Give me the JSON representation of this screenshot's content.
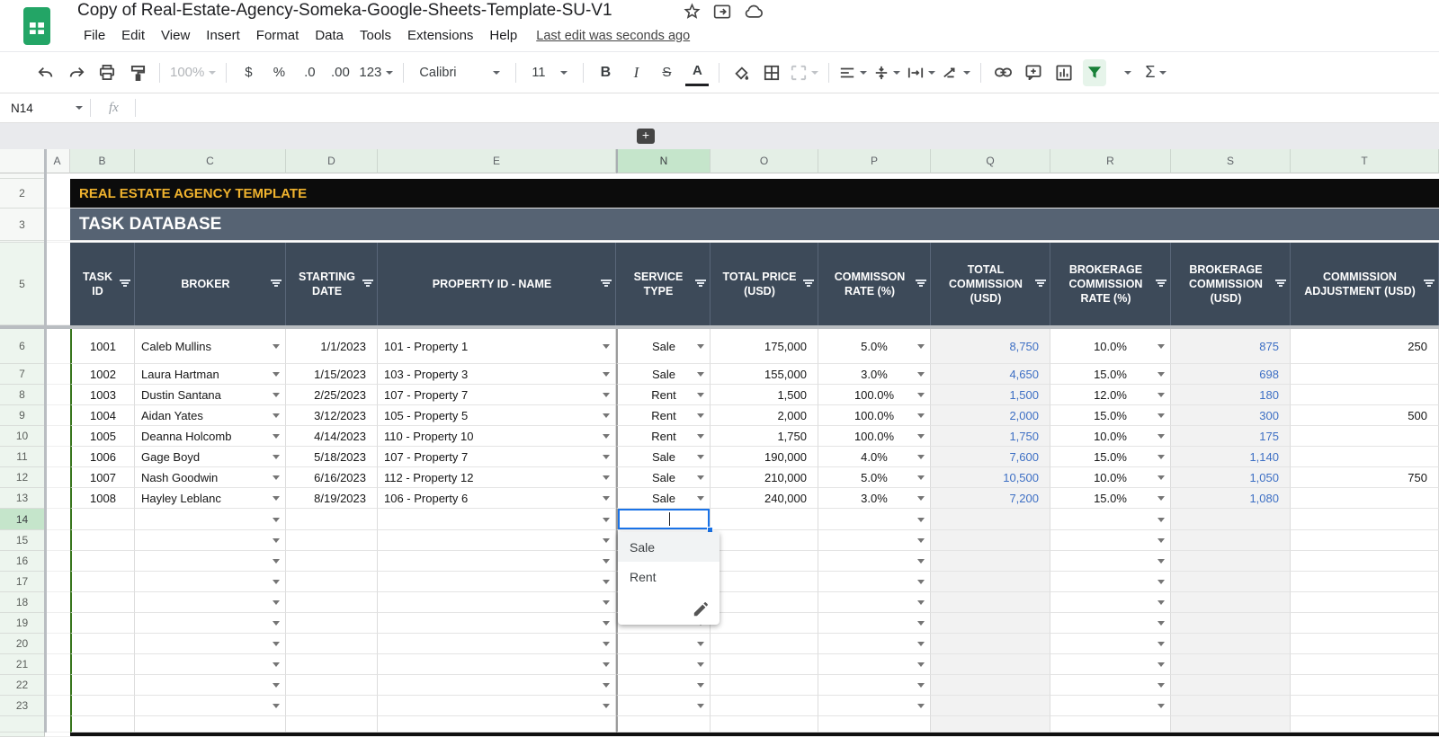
{
  "app": {
    "title": "Copy of Real-Estate-Agency-Someka-Google-Sheets-Template-SU-V1",
    "menu_items": [
      "File",
      "Edit",
      "View",
      "Insert",
      "Format",
      "Data",
      "Tools",
      "Extensions",
      "Help"
    ],
    "last_edit": "Last edit was seconds ago"
  },
  "toolbar": {
    "zoom": "100%",
    "currency": "$",
    "percent": "%",
    "decrease_decimal": ".0",
    "increase_decimal": ".00",
    "more_formats": "123",
    "font": "Calibri",
    "font_size": "11",
    "bold": "B",
    "italic": "I",
    "strikethrough": "S",
    "text_color": "A",
    "functions": "Σ"
  },
  "formula_bar": {
    "name_box": "N14",
    "fx_label": "fx"
  },
  "colors": {
    "accent_blue": "#1a73e8",
    "calc_text_blue": "#3d6fc4",
    "banner_gold": "#f0b32e",
    "header_slate": "#3d4a59",
    "subtitle_slate": "#566373",
    "table_border_green": "#38761d",
    "filter_active_green": "#188038"
  },
  "sheet": {
    "visible_columns": [
      "A",
      "B",
      "C",
      "D",
      "E",
      "N",
      "O",
      "P",
      "Q",
      "R",
      "S",
      "T"
    ],
    "selected_column": "N",
    "selected_row": 14,
    "selected_cell": "N14",
    "expand_columns_button": "+",
    "banner_title": "REAL ESTATE AGENCY TEMPLATE",
    "banner_subtitle": "TASK DATABASE",
    "top_row_numbers": [
      "2",
      "3",
      "5"
    ],
    "headers": [
      "TASK ID",
      "BROKER",
      "STARTING DATE",
      "PROPERTY ID - NAME",
      "SERVICE TYPE",
      "TOTAL PRICE (USD)",
      "COMMISSON RATE (%)",
      "TOTAL COMMISSION (USD)",
      "BROKERAGE COMMISSION RATE (%)",
      "BROKERAGE COMMISSION (USD)",
      "COMMISSION ADJUSTMENT (USD)"
    ],
    "rows": [
      {
        "n": 6,
        "task_id": "1001",
        "broker": "Caleb Mullins",
        "date": "1/1/2023",
        "property": "101 - Property 1",
        "service": "Sale",
        "price": "175,000",
        "rate": "5.0%",
        "commission": "8,750",
        "brokerage_rate": "10.0%",
        "brokerage": "875",
        "adjustment": "250"
      },
      {
        "n": 7,
        "task_id": "1002",
        "broker": "Laura Hartman",
        "date": "1/15/2023",
        "property": "103 - Property 3",
        "service": "Sale",
        "price": "155,000",
        "rate": "3.0%",
        "commission": "4,650",
        "brokerage_rate": "15.0%",
        "brokerage": "698",
        "adjustment": ""
      },
      {
        "n": 8,
        "task_id": "1003",
        "broker": "Dustin Santana",
        "date": "2/25/2023",
        "property": "107 - Property 7",
        "service": "Rent",
        "price": "1,500",
        "rate": "100.0%",
        "commission": "1,500",
        "brokerage_rate": "12.0%",
        "brokerage": "180",
        "adjustment": ""
      },
      {
        "n": 9,
        "task_id": "1004",
        "broker": "Aidan Yates",
        "date": "3/12/2023",
        "property": "105 - Property 5",
        "service": "Rent",
        "price": "2,000",
        "rate": "100.0%",
        "commission": "2,000",
        "brokerage_rate": "15.0%",
        "brokerage": "300",
        "adjustment": "500"
      },
      {
        "n": 10,
        "task_id": "1005",
        "broker": "Deanna Holcomb",
        "date": "4/14/2023",
        "property": "110 - Property 10",
        "service": "Rent",
        "price": "1,750",
        "rate": "100.0%",
        "commission": "1,750",
        "brokerage_rate": "10.0%",
        "brokerage": "175",
        "adjustment": ""
      },
      {
        "n": 11,
        "task_id": "1006",
        "broker": "Gage Boyd",
        "date": "5/18/2023",
        "property": "107 - Property 7",
        "service": "Sale",
        "price": "190,000",
        "rate": "4.0%",
        "commission": "7,600",
        "brokerage_rate": "15.0%",
        "brokerage": "1,140",
        "adjustment": ""
      },
      {
        "n": 12,
        "task_id": "1007",
        "broker": "Nash Goodwin",
        "date": "6/16/2023",
        "property": "112 - Property 12",
        "service": "Sale",
        "price": "210,000",
        "rate": "5.0%",
        "commission": "10,500",
        "brokerage_rate": "10.0%",
        "brokerage": "1,050",
        "adjustment": "750"
      },
      {
        "n": 13,
        "task_id": "1008",
        "broker": "Hayley Leblanc",
        "date": "8/19/2023",
        "property": "106 - Property 6",
        "service": "Sale",
        "price": "240,000",
        "rate": "3.0%",
        "commission": "7,200",
        "brokerage_rate": "15.0%",
        "brokerage": "1,080",
        "adjustment": ""
      }
    ],
    "empty_row_numbers": [
      15,
      16,
      17,
      18,
      19,
      20,
      21,
      22,
      23
    ],
    "dropdown": {
      "options": [
        "Sale",
        "Rent"
      ],
      "highlighted": "Sale"
    }
  }
}
